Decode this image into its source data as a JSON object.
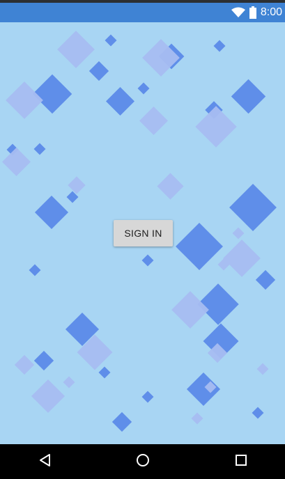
{
  "status_bar": {
    "time": "8:00",
    "icons": [
      "wifi-icon",
      "battery-icon"
    ],
    "background": "#3f83d4"
  },
  "main": {
    "background": "#a8d5f3",
    "sign_in_label": "SIGN IN",
    "diamond_colors": {
      "dark": "#5f8ee9",
      "light": "#a7bdf1"
    }
  },
  "nav_bar": {
    "icons": [
      "back-icon",
      "home-icon",
      "recents-icon"
    ]
  }
}
